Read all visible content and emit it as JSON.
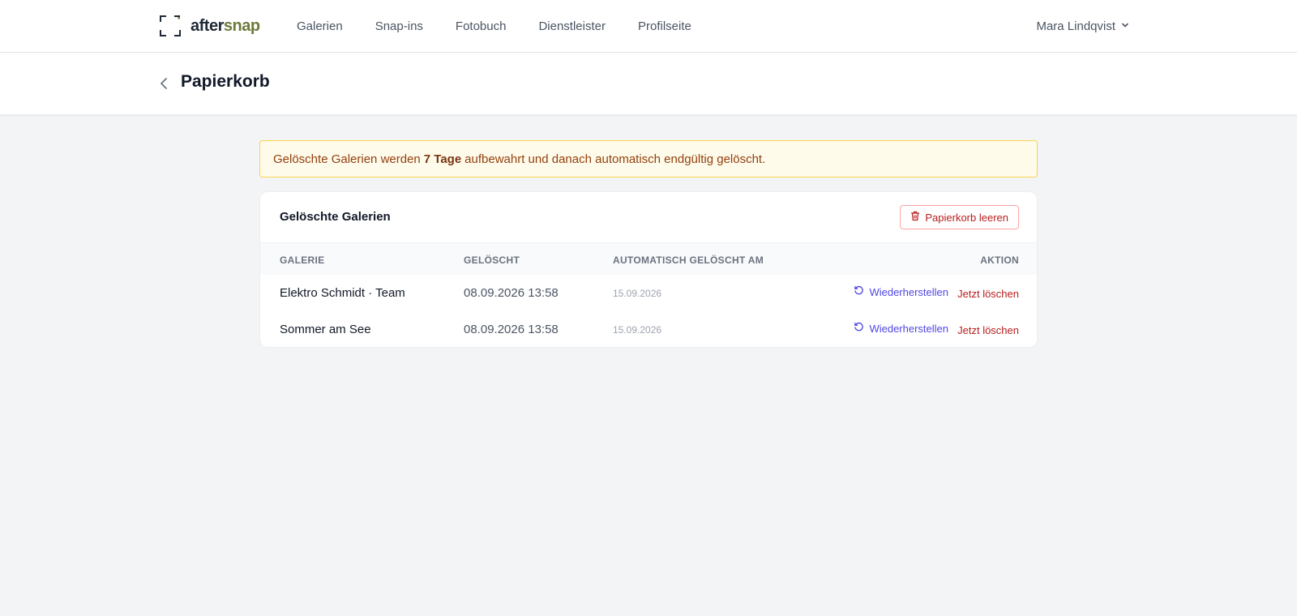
{
  "brand": {
    "name_part1": "after",
    "name_part2": "snap",
    "color_accent": "#6b7a3a"
  },
  "nav": {
    "items": [
      {
        "label": "Galerien"
      },
      {
        "label": "Snap-ins"
      },
      {
        "label": "Fotobuch"
      },
      {
        "label": "Dienstleister"
      },
      {
        "label": "Profilseite"
      }
    ]
  },
  "user": {
    "name": "Mara Lindqvist",
    "icon": "chevron-down-icon"
  },
  "page": {
    "title": "Papierkorb",
    "back_icon": "chevron-left-icon"
  },
  "notice": {
    "text_before": "Gelöschte Galerien werden",
    "highlight": "7 Tage",
    "text_after": "aufbewahrt und danach automatisch endgültig gelöscht."
  },
  "card": {
    "title": "Gelöschte Galerien",
    "empty_button": "Papierkorb leeren",
    "columns": {
      "gallery": "GALERIE",
      "deleted": "GELÖSCHT",
      "auto_deleted": "AUTOMATISCH GELÖSCHT AM",
      "action": "AKTION"
    },
    "rows": [
      {
        "name": "Elektro Schmidt · Team",
        "deleted": "08.09.2026 13:58",
        "auto_deleted": "15.09.2026",
        "restore_label": "Wiederherstellen",
        "delete_label": "Jetzt löschen"
      },
      {
        "name": "Sommer am See",
        "deleted": "08.09.2026 13:58",
        "auto_deleted": "15.09.2026",
        "restore_label": "Wiederherstellen",
        "delete_label": "Jetzt löschen"
      }
    ]
  }
}
